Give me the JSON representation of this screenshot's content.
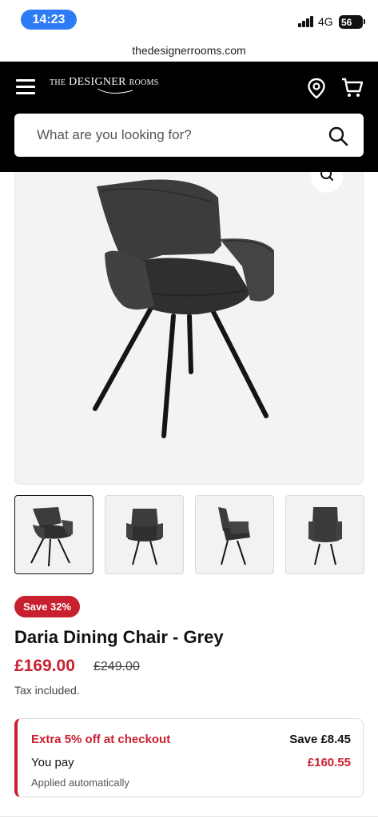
{
  "status_bar": {
    "time": "14:23",
    "network": "4G",
    "battery": "56"
  },
  "browser": {
    "url": "thedesignerrooms.com"
  },
  "header": {
    "logo_prefix": "THE",
    "logo_main": "DESIGNER",
    "logo_suffix": "ROOMS",
    "search_placeholder": "What are you looking for?",
    "icons": [
      "menu-icon",
      "location-pin-icon",
      "cart-icon",
      "search-icon"
    ]
  },
  "gallery": {
    "thumbnails": [
      "front-angle",
      "front",
      "side",
      "back"
    ],
    "active_index": 0,
    "zoom_icon": "zoom-icon"
  },
  "product": {
    "badge": "Save 32%",
    "title": "Daria Dining Chair - Grey",
    "price_now": "£169.00",
    "price_was": "£249.00",
    "tax_note": "Tax included."
  },
  "promo": {
    "headline": "Extra 5% off at checkout",
    "save_amount": "Save £8.45",
    "you_pay_label": "You pay",
    "you_pay_price": "£160.55",
    "note": "Applied automatically"
  },
  "colors": {
    "accent_red": "#c8202f",
    "header_bg": "#000000",
    "time_pill": "#2d7cf6"
  }
}
